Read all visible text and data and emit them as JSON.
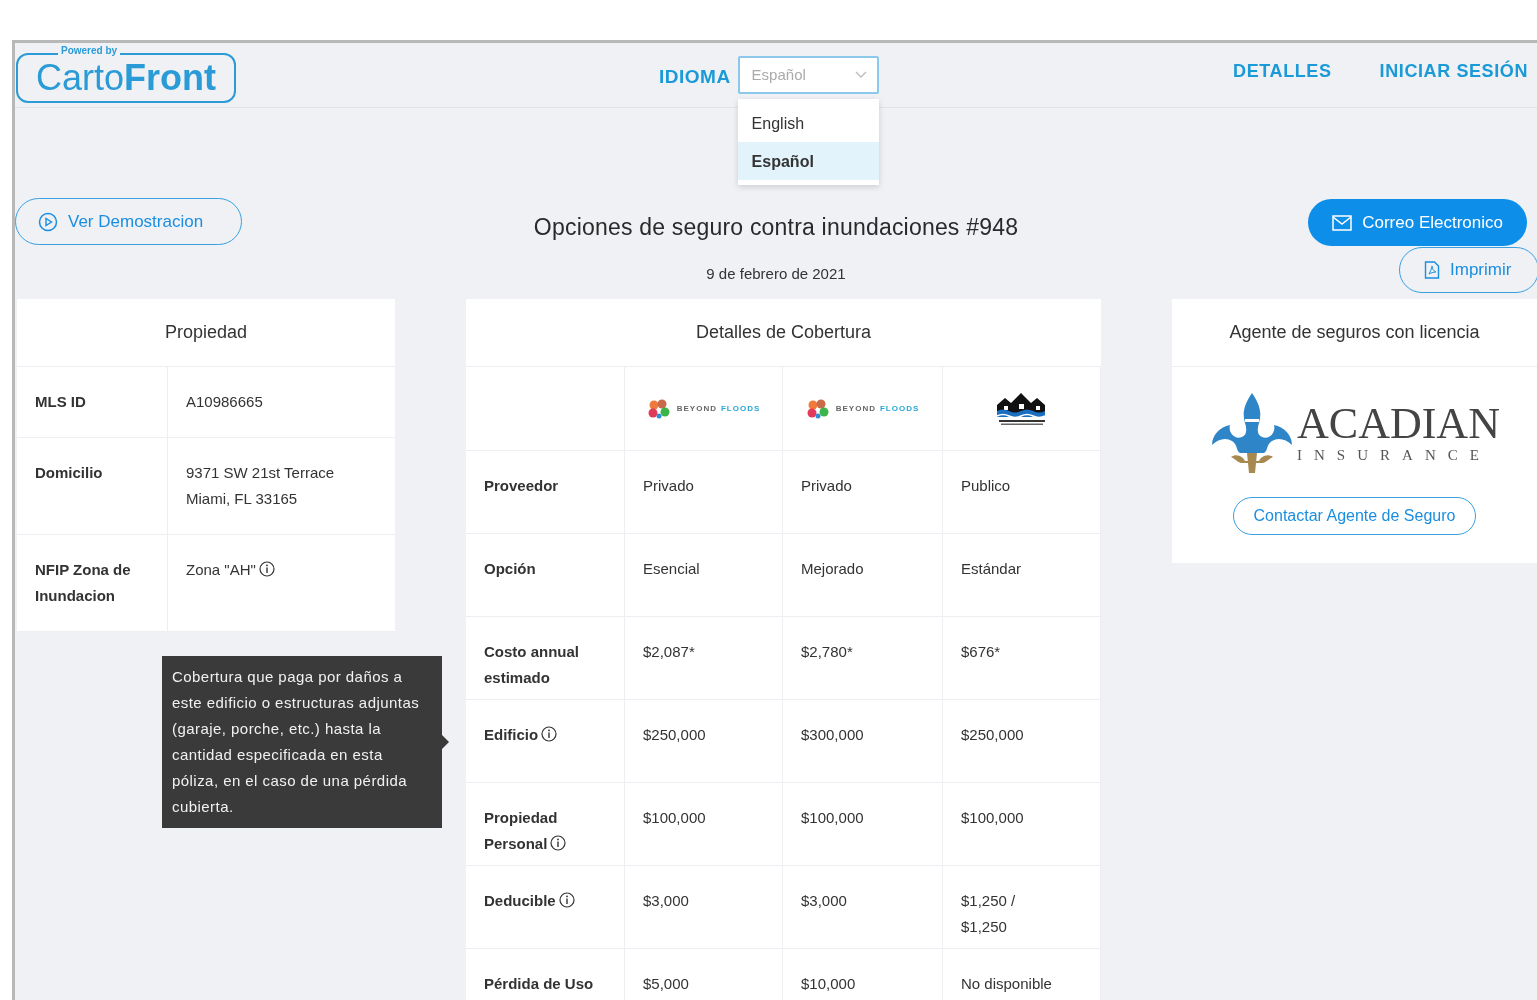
{
  "header": {
    "logo": {
      "tagline": "Powered by",
      "name": "Carto**Front**"
    },
    "language": {
      "label": "IDIOMA",
      "placeholder": "Español",
      "options": [
        {
          "label": "English",
          "selected": false
        },
        {
          "label": "Español",
          "selected": true
        }
      ]
    },
    "nav": [
      "DETALLES",
      "INICIAR SESIÓN"
    ]
  },
  "toolbar": {
    "demo_button": "Ver Demostracion",
    "title": "Opciones de seguro contra inundaciones #948",
    "date": "9 de febrero de 2021",
    "email_button": "Correo Electronico",
    "print_button": "Imprimir"
  },
  "property": {
    "title": "Propiedad",
    "rows": [
      {
        "label": "MLS ID",
        "value": "A10986665",
        "info": false
      },
      {
        "label": "Domicilio",
        "value": "9371 SW 21st Terrace\nMiami, FL 33165",
        "info": false
      },
      {
        "label": "NFIP Zona de Inundacion",
        "value": "Zona \"AH\"",
        "info": true
      }
    ]
  },
  "tooltip": "Cobertura que paga por daños a este edificio o estructuras adjuntas (garaje, porche, etc.) hasta la cantidad especificada en esta póliza, en el caso de una pérdida cubierta.",
  "coverage": {
    "title": "Detalles de Cobertura",
    "providers": [
      {
        "kind": "beyond",
        "word1": "BEYOND",
        "word2": "FLOODS"
      },
      {
        "kind": "beyond",
        "word1": "BEYOND",
        "word2": "FLOODS"
      },
      {
        "kind": "nfip"
      }
    ],
    "rows": [
      {
        "label": "Proveedor",
        "info": false,
        "cells": [
          "Privado",
          "Privado",
          "Publico"
        ]
      },
      {
        "label": "Opción",
        "info": false,
        "cells": [
          "Esencial",
          "Mejorado",
          "Estándar"
        ]
      },
      {
        "label": "Costo annual estimado",
        "info": false,
        "cells": [
          "$2,087*",
          "$2,780*",
          "$676*"
        ]
      },
      {
        "label": "Edificio",
        "info": true,
        "cells": [
          "$250,000",
          "$300,000",
          "$250,000"
        ]
      },
      {
        "label": "Propiedad Personal",
        "info": true,
        "cells": [
          "$100,000",
          "$100,000",
          "$100,000"
        ]
      },
      {
        "label": "Deducible",
        "info": true,
        "cells": [
          "$3,000",
          "$3,000",
          "$1,250 /\n$1,250"
        ]
      },
      {
        "label": "Pérdida de Uso",
        "cells": [
          "$5,000",
          "$10,000",
          "No disponible"
        ]
      }
    ]
  },
  "agent": {
    "title": "Agente de seguros con licencia",
    "logo": {
      "name": "ACADIAN",
      "sub": "INSURANCE"
    },
    "button": "Contactar Agente de Seguro"
  }
}
